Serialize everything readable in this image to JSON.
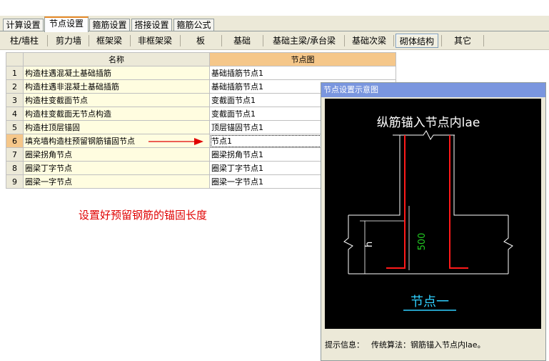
{
  "tabs": [
    "计算设置",
    "节点设置",
    "箍筋设置",
    "搭接设置",
    "箍筋公式"
  ],
  "subtabs": [
    "柱/墙柱",
    "剪力墙",
    "框架梁",
    "非框架梁",
    "板",
    "基础",
    "基础主梁/承台梁",
    "基础次梁",
    "砌体结构",
    "其它"
  ],
  "table": {
    "headers": [
      "名称",
      "节点图"
    ],
    "rows": [
      {
        "num": "1",
        "name": "构造柱遇混凝土基础插筋",
        "node": "基础插筋节点1"
      },
      {
        "num": "2",
        "name": "构造柱遇非混凝土基础插筋",
        "node": "基础插筋节点1"
      },
      {
        "num": "3",
        "name": "构造柱变截面节点",
        "node": "变截面节点1"
      },
      {
        "num": "4",
        "name": "构造柱变截面无节点构造",
        "node": "变截面节点1"
      },
      {
        "num": "5",
        "name": "构造柱顶层锚固",
        "node": "顶层锚固节点1"
      },
      {
        "num": "6",
        "name": "填充墙构造柱预留钢筋锚固节点",
        "node": "节点1"
      },
      {
        "num": "7",
        "name": "圈梁拐角节点",
        "node": "圈梁拐角节点1"
      },
      {
        "num": "8",
        "name": "圈梁丁字节点",
        "node": "圈梁丁字节点1"
      },
      {
        "num": "9",
        "name": "圈梁一字节点",
        "node": "圈梁一字节点1"
      }
    ]
  },
  "annotation": "设置好预留钢筋的锚固长度",
  "panel": {
    "title": "节点设置示意图",
    "diagram_title": "纵筋锚入节点内lae",
    "dim_500": "500",
    "dim_h": "h",
    "node_caption": "节点一",
    "hint_label": "提示信息：",
    "hint_text": "传统算法：钢筋锚入节点内lae。"
  },
  "colors": {
    "accent_orange": "#e68b2c",
    "selected_header": "#f5c78a",
    "name_cell_bg": "#fffde0",
    "annotation_red": "#e00000",
    "rebar_red": "#ff1a1a",
    "dim_green": "#22cc22",
    "caption_cyan": "#2fd0ff"
  }
}
